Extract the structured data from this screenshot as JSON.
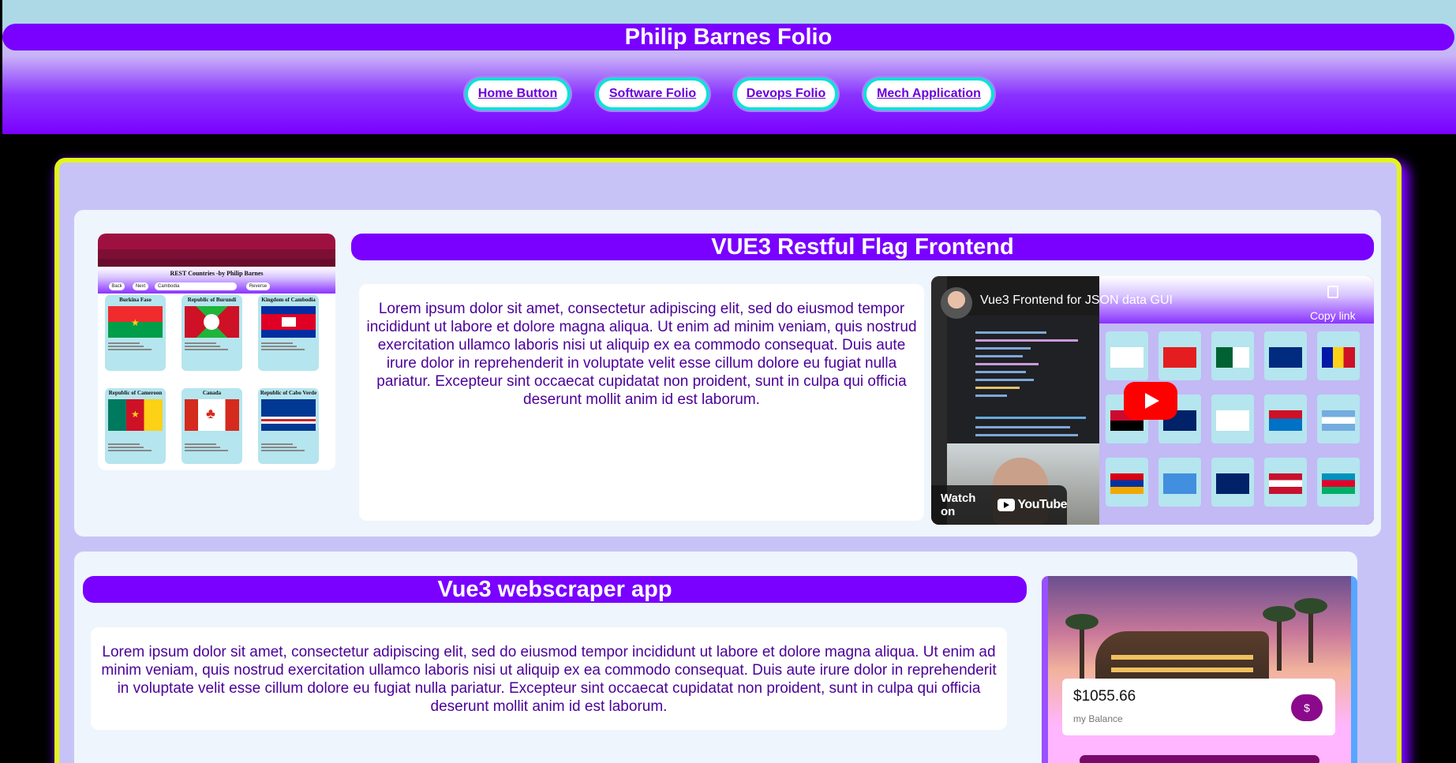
{
  "header": {
    "title": "Philip Barnes Folio",
    "nav": [
      {
        "label": "Home Button"
      },
      {
        "label": "Software Folio"
      },
      {
        "label": "Devops Folio"
      },
      {
        "label": "Mech Application"
      }
    ]
  },
  "project1": {
    "title": "VUE3 Restful Flag Frontend",
    "description": "Lorem ipsum dolor sit amet, consectetur adipiscing elit, sed do eiusmod tempor incididunt ut labore et dolore magna aliqua. Ut enim ad minim veniam, quis nostrud exercitation ullamco laboris nisi ut aliquip ex ea commodo consequat. Duis aute irure dolor in reprehenderit in voluptate velit esse cillum dolore eu fugiat nulla pariatur. Excepteur sint occaecat cupidatat non proident, sunt in culpa qui officia deserunt mollit anim id est laborum.",
    "thumbnail": {
      "page_title": "REST Countries -by Philip Barnes",
      "back_label": "Back",
      "next_label": "Next",
      "select_value": "Cambodia",
      "reverse_label": "Reverse",
      "countries": [
        {
          "name": "Burkina Faso"
        },
        {
          "name": "Republic of Burundi"
        },
        {
          "name": "Kingdom of Cambodia"
        },
        {
          "name": "Republic of Cameroon"
        },
        {
          "name": "Canada"
        },
        {
          "name": "Republic of Cabo Verde"
        }
      ]
    },
    "video": {
      "title": "Vue3 Frontend for JSON data GUI",
      "copy_link": "Copy link",
      "watch_on": "Watch on",
      "youtube": "YouTube"
    }
  },
  "project2": {
    "title": "Vue3 webscraper app",
    "description": "Lorem ipsum dolor sit amet, consectetur adipiscing elit, sed do eiusmod tempor incididunt ut labore et dolore magna aliqua. Ut enim ad minim veniam, quis nostrud exercitation ullamco laboris nisi ut aliquip ex ea commodo consequat. Duis aute irure dolor in reprehenderit in voluptate velit esse cillum dolore eu fugiat nulla pariatur. Excepteur sint occaecat cupidatat non proident, sunt in culpa qui officia deserunt mollit anim id est laborum.",
    "balance": {
      "amount": "$1055.66",
      "label": "my Balance",
      "button_icon": "$"
    }
  },
  "colors": {
    "accent": "#7a00ff",
    "nav_border": "#10e0d8",
    "frame_border": "#e3f51c",
    "frame_bg": "#c8c3f7",
    "text": "#4b0099"
  }
}
